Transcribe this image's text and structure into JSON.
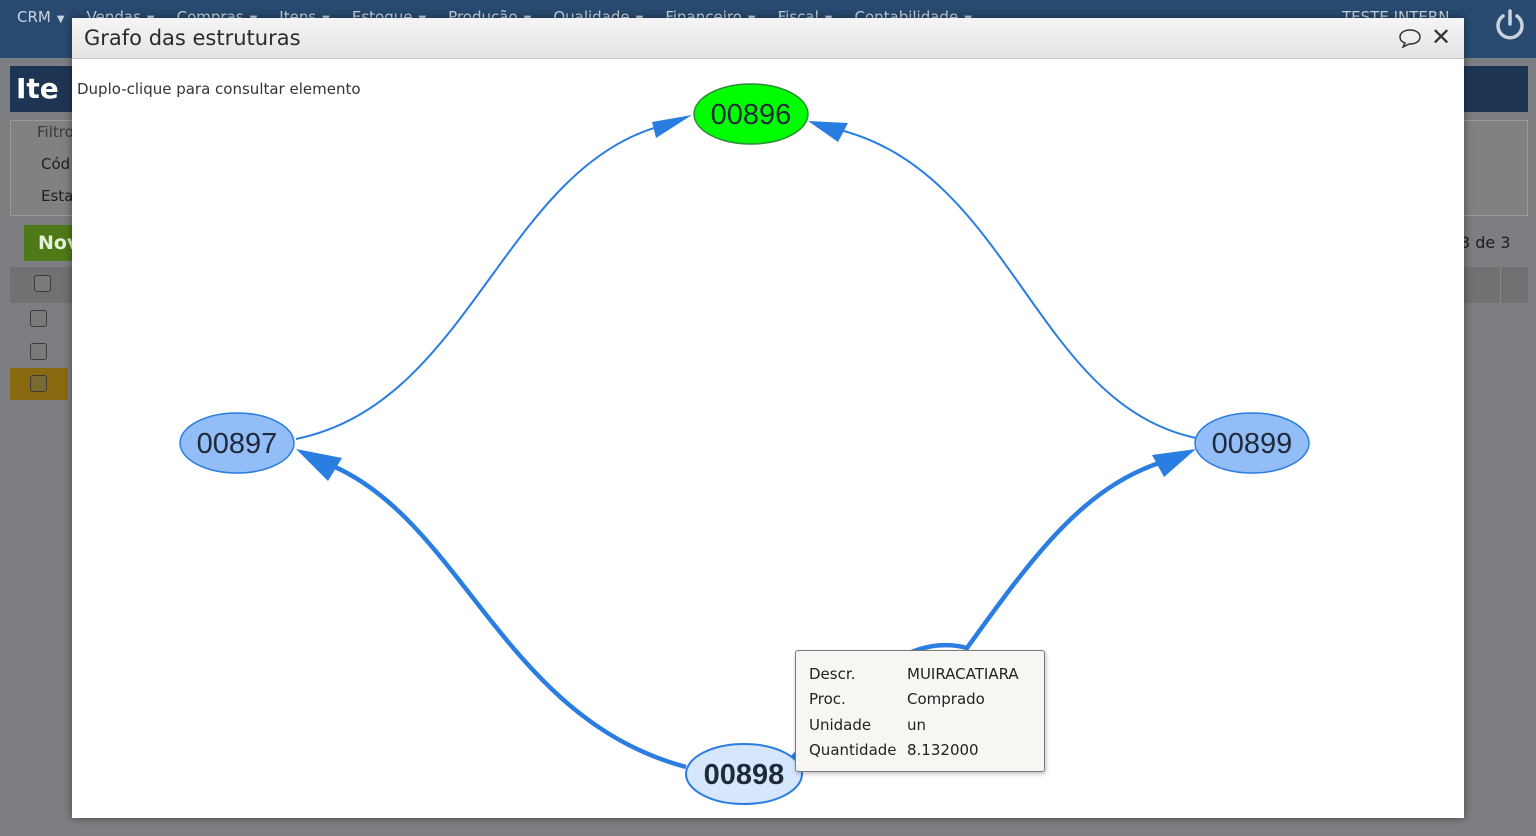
{
  "app": {
    "menu": [
      "CRM",
      "Vendas",
      "Compras",
      "Itens",
      "Estoque",
      "Produção",
      "Qualidade",
      "Financeiro",
      "Fiscal",
      "Contabilidade"
    ],
    "user_label": "TESTE INTERN...",
    "page_title": "Ite",
    "filter_legend": "Filtro",
    "filter_field_1": "Cód",
    "filter_field_2": "Esta",
    "new_button": "Nov",
    "pager_text": "3 de 3"
  },
  "dialog": {
    "title": "Grafo das estruturas",
    "hint": "Duplo-clique para consultar elemento"
  },
  "graph": {
    "nodes": [
      {
        "id": "n896",
        "label": "00896",
        "fill": "#00ff00",
        "stroke": "#2e8b3a"
      },
      {
        "id": "n897",
        "label": "00897",
        "fill": "#93bdf6",
        "stroke": "#2a7de1"
      },
      {
        "id": "n899",
        "label": "00899",
        "fill": "#93bdf6",
        "stroke": "#2a7de1"
      },
      {
        "id": "n898",
        "label": "00898",
        "fill": "#d6e6fd",
        "stroke": "#2a7de1",
        "bold": true
      }
    ],
    "edges": [
      {
        "from": "00897",
        "to": "00896",
        "highlighted": false
      },
      {
        "from": "00899",
        "to": "00896",
        "highlighted": false
      },
      {
        "from": "00898",
        "to": "00897",
        "highlighted": true
      },
      {
        "from": "00898",
        "to": "00899",
        "highlighted": true
      }
    ],
    "edge_color": "#2a7de1"
  },
  "tooltip": {
    "rows": [
      {
        "key": "Descr.",
        "value": "MUIRACATIARA"
      },
      {
        "key": "Proc.",
        "value": "Comprado"
      },
      {
        "key": "Unidade",
        "value": "un"
      },
      {
        "key": "Quantidade",
        "value": "8.132000"
      }
    ]
  }
}
